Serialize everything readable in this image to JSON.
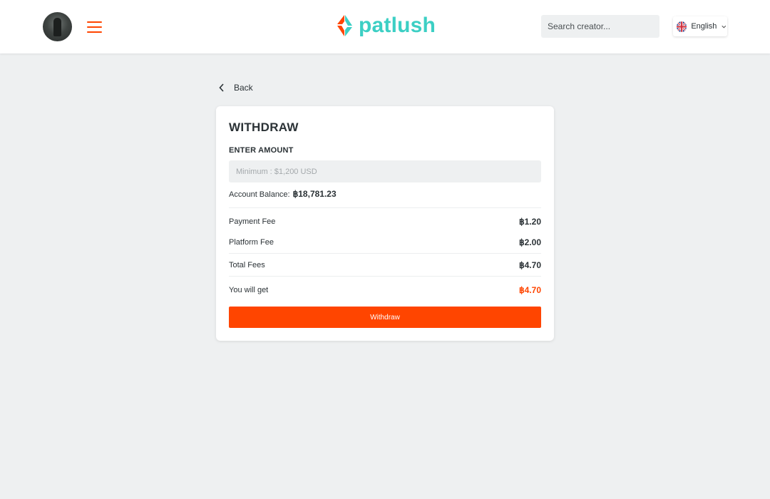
{
  "header": {
    "logo_text": "patlush",
    "search_placeholder": "Search creator...",
    "language": "English"
  },
  "nav": {
    "back_label": "Back"
  },
  "withdraw": {
    "title": "WITHDRAW",
    "amount_label": "ENTER AMOUNT",
    "amount_placeholder": "Minimum : $1,200 USD",
    "amount_value": "",
    "balance_label": "Account Balance:",
    "balance_value": "฿18,781.23",
    "fees": [
      {
        "label": "Payment Fee",
        "value": "฿1.20"
      },
      {
        "label": "Platform Fee",
        "value": "฿2.00"
      },
      {
        "label": "Total Fees",
        "value": "฿4.70"
      }
    ],
    "you_get_label": "You will get",
    "you_get_value": "฿4.70",
    "button_label": "Withdraw"
  },
  "colors": {
    "accent": "#ff4500",
    "brand_teal": "#3ccfc4",
    "background": "#eef0f1"
  },
  "icons": {
    "menu": "hamburger-icon",
    "back": "chevron-left-icon",
    "language_flag": "uk-flag-icon",
    "language_dropdown": "chevron-down-icon"
  }
}
